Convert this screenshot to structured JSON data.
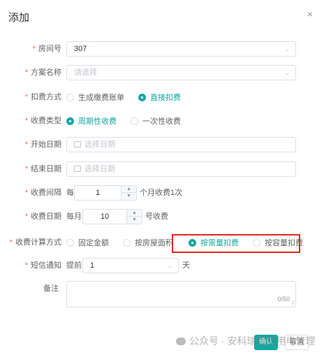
{
  "dialog": {
    "title": "添加",
    "close_glyph": "×"
  },
  "form": {
    "room": {
      "label": "房间号",
      "value": "307"
    },
    "plan": {
      "label": "方案名称",
      "placeholder": "请选择"
    },
    "deduct_method": {
      "label": "扣费方式",
      "options": [
        "生成缴费账单",
        "直接扣费"
      ],
      "selected": "直接扣费"
    },
    "charge_type": {
      "label": "收费类型",
      "options": [
        "周期性收费",
        "一次性收费"
      ],
      "selected": "周期性收费"
    },
    "start_date": {
      "label": "开始日期",
      "placeholder": "选择日期"
    },
    "end_date": {
      "label": "结束日期",
      "placeholder": "选择日期"
    },
    "interval": {
      "label": "收费间隔",
      "prefix": "每",
      "value": "1",
      "suffix": "个月收费1次"
    },
    "charge_day": {
      "label": "收费日期",
      "prefix": "每月",
      "value": "10",
      "suffix": "号收费"
    },
    "calc_method": {
      "label": "收费计算方式",
      "options": [
        "固定金额",
        "按房屋面积",
        "按需量扣费",
        "按容量扣费"
      ],
      "selected": "按需量扣费"
    },
    "sms": {
      "label": "短信通知",
      "prefix": "提前",
      "value": "1",
      "suffix": "天"
    },
    "remark": {
      "label": "备注",
      "counter": "0/50"
    }
  },
  "footer": {
    "confirm_label": "确认",
    "cancel_label": "取消"
  },
  "watermark": {
    "text": "公众号 · 安科瑞智慧用电管理"
  },
  "colors": {
    "accent": "#13a8a0",
    "required": "#f56c6c",
    "highlight_border": "#e0281e"
  },
  "icons": {
    "close": "close-icon",
    "chevron": "chevron-down-icon",
    "calendar": "calendar-icon",
    "wechat": "wechat-icon"
  }
}
